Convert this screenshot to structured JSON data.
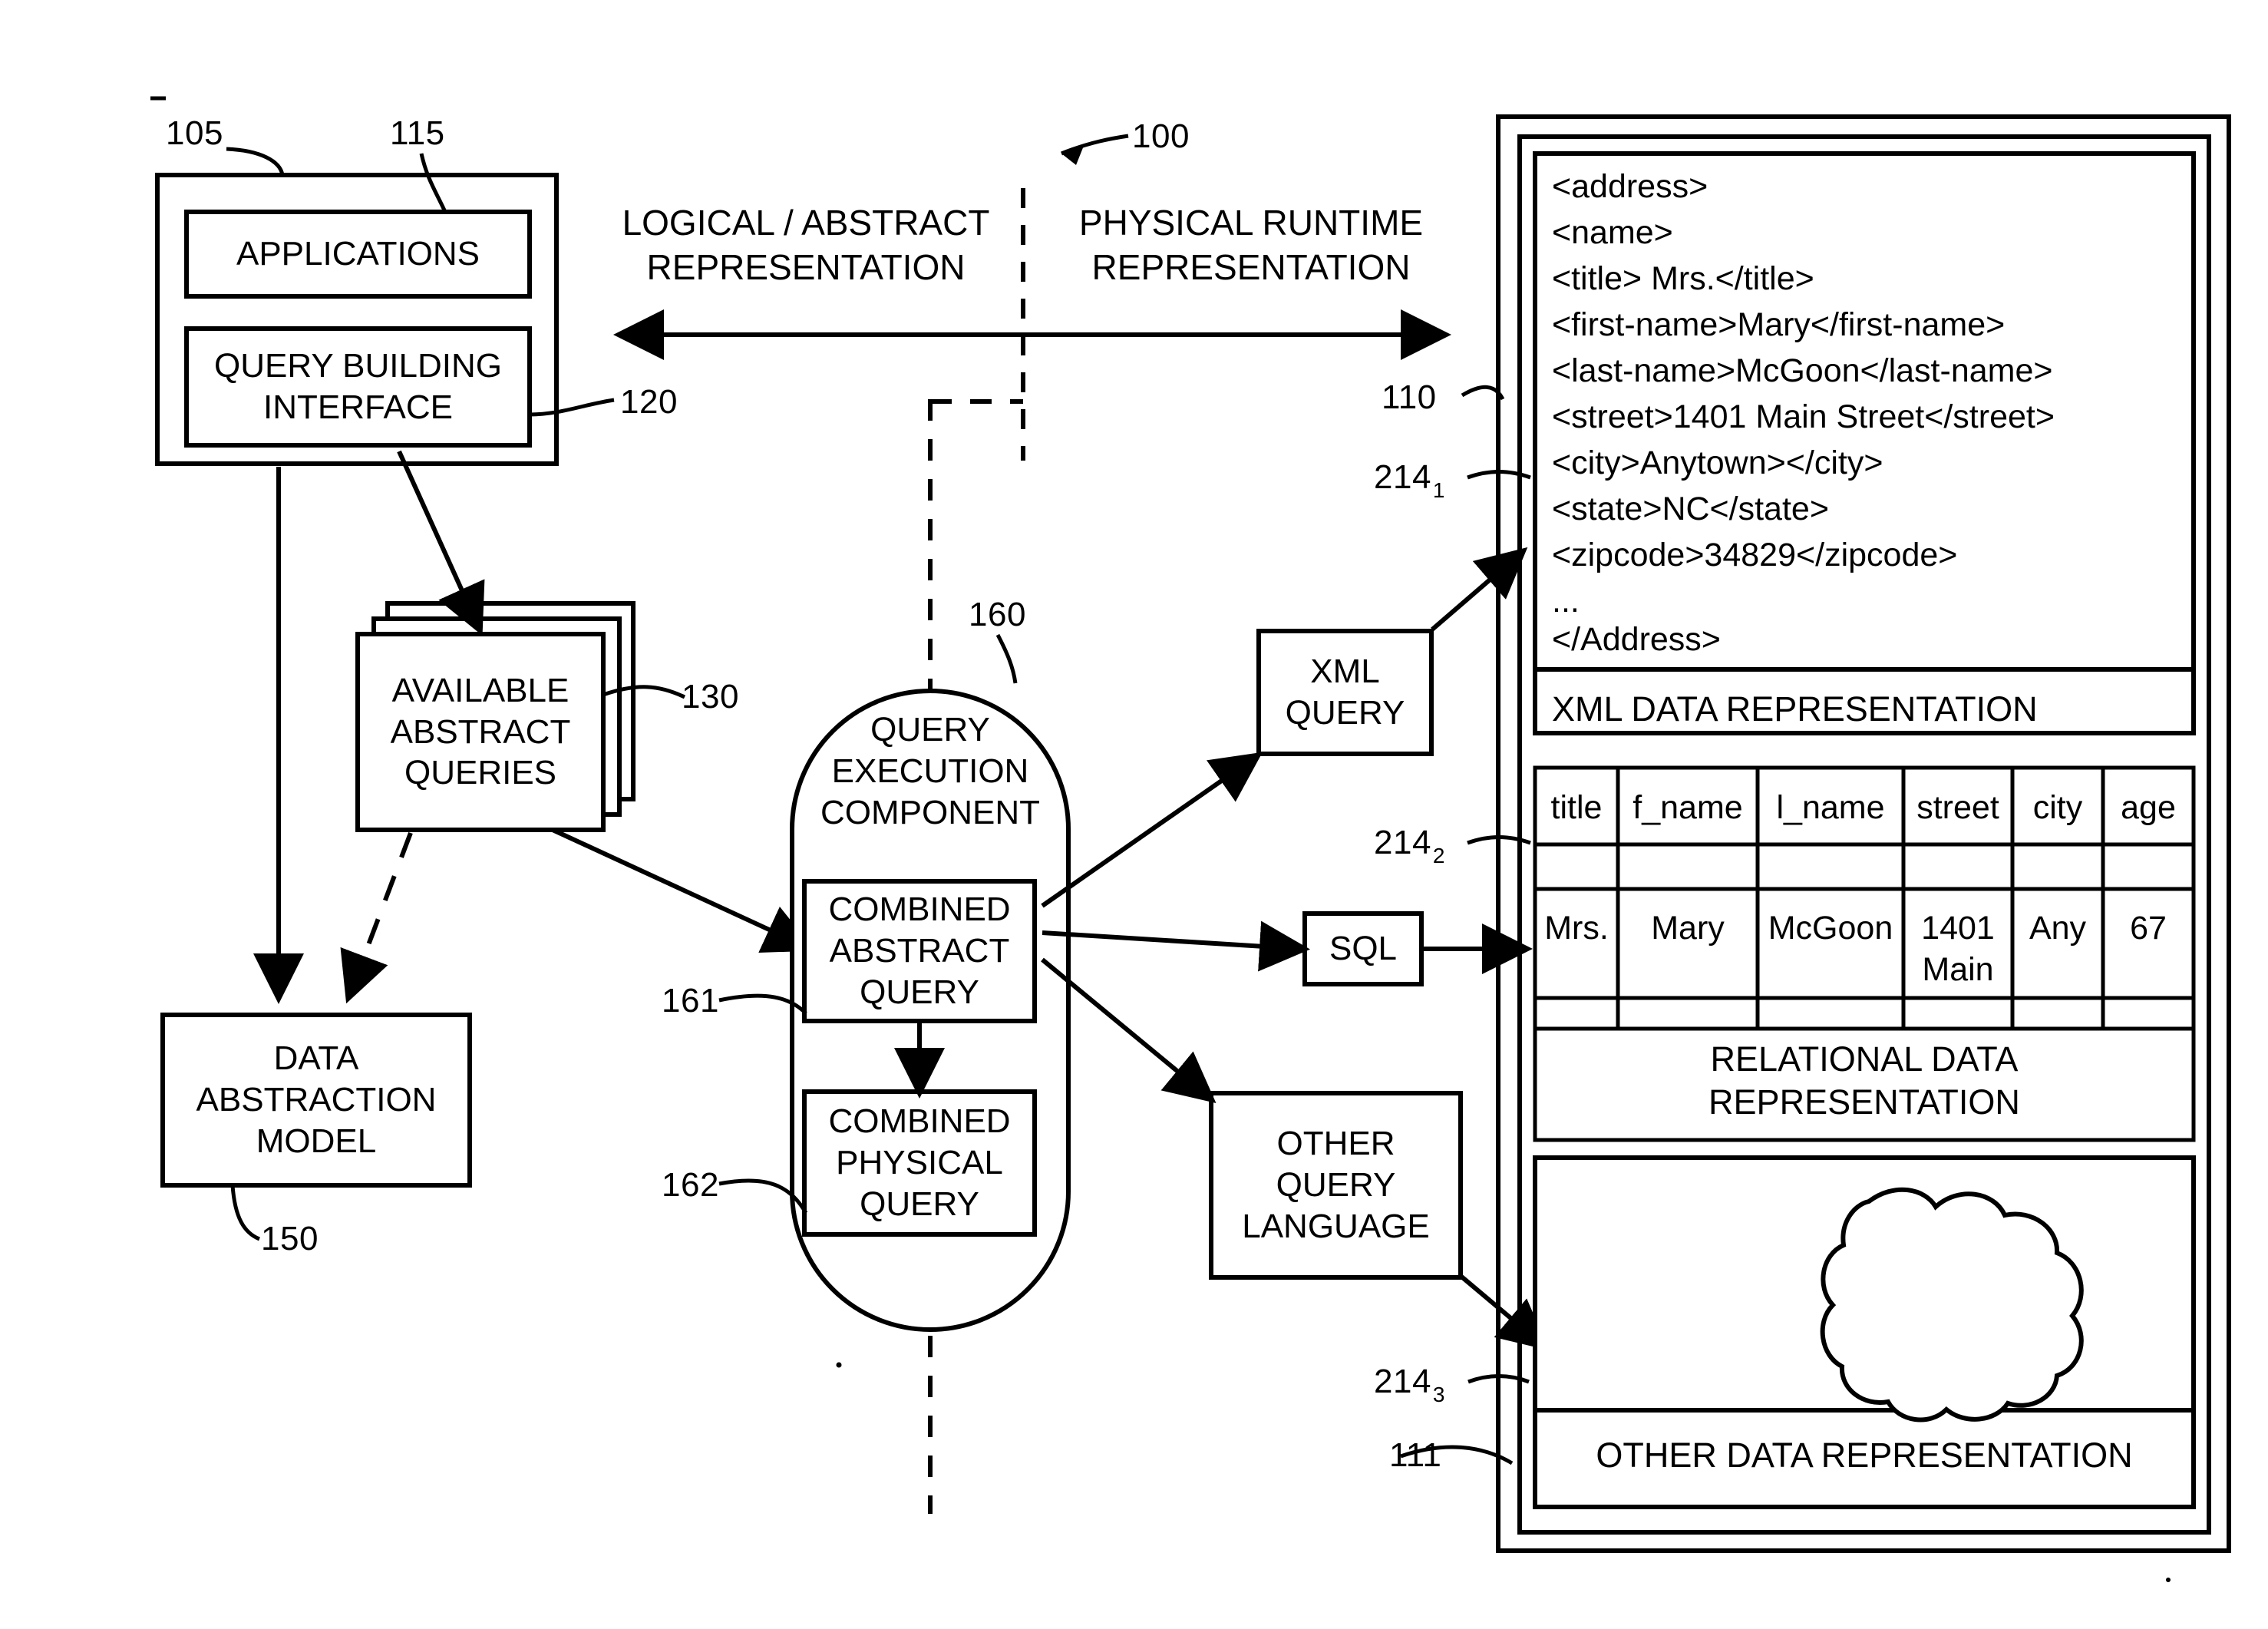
{
  "figure": {
    "system_ref": "100",
    "divider_left_title": "LOGICAL / ABSTRACT\nREPRESENTATION",
    "divider_left_line1": "LOGICAL / ABSTRACT",
    "divider_left_line2": "REPRESENTATION",
    "divider_right_line1": "PHYSICAL RUNTIME",
    "divider_right_line2": "REPRESENTATION"
  },
  "left_panel": {
    "outer_ref": "105",
    "applications": {
      "label": "APPLICATIONS",
      "ref": "115"
    },
    "query_building_interface": {
      "line1": "QUERY BUILDING",
      "line2": "INTERFACE",
      "ref": "120"
    },
    "available_abstract_queries": {
      "line1": "AVAILABLE",
      "line2": "ABSTRACT",
      "line3": "QUERIES",
      "ref": "130"
    },
    "data_abstraction_model": {
      "line1": "DATA",
      "line2": "ABSTRACTION",
      "line3": "MODEL",
      "ref": "150"
    }
  },
  "center": {
    "query_execution_component": {
      "line1": "QUERY",
      "line2": "EXECUTION",
      "line3": "COMPONENT",
      "ref": "160"
    },
    "combined_abstract_query": {
      "line1": "COMBINED",
      "line2": "ABSTRACT",
      "line3": "QUERY",
      "ref": "161"
    },
    "combined_physical_query": {
      "line1": "COMBINED",
      "line2": "PHYSICAL",
      "line3": "QUERY",
      "ref": "162"
    }
  },
  "query_languages": {
    "xml_query": {
      "line1": "XML",
      "line2": "QUERY"
    },
    "sql": {
      "label": "SQL"
    },
    "other_query_language": {
      "line1": "OTHER",
      "line2": "QUERY",
      "line3": "LANGUAGE"
    }
  },
  "right_panel": {
    "outer_ref": "110",
    "inner_ref": "111",
    "xml_representation": {
      "ref": "214",
      "ref_sub": "1",
      "caption": "XML DATA REPRESENTATION",
      "lines": [
        "<address>",
        "<name>",
        "<title> Mrs.</title>",
        "<first-name>Mary</first-name>",
        "<last-name>McGoon</last-name>",
        "<street>1401 Main Street</street>",
        "<city>Anytown></city>",
        "<state>NC</state>",
        "<zipcode>34829</zipcode>",
        "...",
        "</Address>"
      ]
    },
    "relational_representation": {
      "ref": "214",
      "ref_sub": "2",
      "caption_line1": "RELATIONAL DATA",
      "caption_line2": "REPRESENTATION",
      "columns": [
        "title",
        "f_name",
        "l_name",
        "street",
        "city",
        "age"
      ],
      "rows": [
        [
          "",
          "",
          "",
          "",
          "",
          ""
        ],
        [
          "Mrs.",
          "Mary",
          "McGoon",
          "1401\nMain",
          "Any",
          "67"
        ],
        [
          "",
          "",
          "",
          "",
          "",
          ""
        ]
      ],
      "row_values": {
        "title": "Mrs.",
        "f_name": "Mary",
        "l_name": "McGoon",
        "street_line1": "1401",
        "street_line2": "Main",
        "city": "Any",
        "age": "67"
      }
    },
    "other_representation": {
      "ref": "214",
      "ref_sub": "3",
      "caption": "OTHER DATA REPRESENTATION",
      "shape": "cloud"
    }
  },
  "colors": {
    "ink": "#000000",
    "paper": "#ffffff"
  }
}
